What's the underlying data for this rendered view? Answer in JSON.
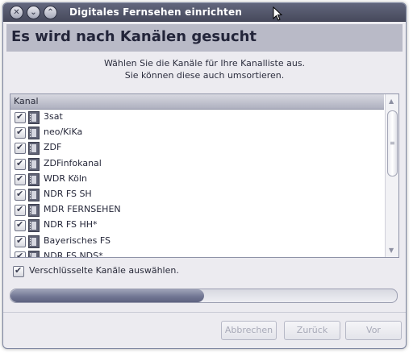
{
  "window": {
    "title": "Digitales Fernsehen einrichten"
  },
  "header": {
    "title": "Es wird nach Kanälen gesucht"
  },
  "intro": {
    "line1": "Wählen Sie die Kanäle für Ihre Kanalliste aus.",
    "line2": "Sie können diese auch umsortieren."
  },
  "channel_list": {
    "column_header": "Kanal",
    "channels": [
      {
        "name": "3sat",
        "checked": true
      },
      {
        "name": "neo/KiKa",
        "checked": true
      },
      {
        "name": "ZDF",
        "checked": true
      },
      {
        "name": "ZDFinfokanal",
        "checked": true
      },
      {
        "name": "WDR Köln",
        "checked": true
      },
      {
        "name": "NDR FS SH",
        "checked": true
      },
      {
        "name": "MDR FERNSEHEN",
        "checked": true
      },
      {
        "name": "NDR FS HH*",
        "checked": true
      },
      {
        "name": "Bayerisches FS",
        "checked": true
      },
      {
        "name": "NDR FS NDS*",
        "checked": true
      }
    ]
  },
  "options": {
    "encrypted_label": "Verschlüsselte Kanäle auswählen.",
    "encrypted_checked": true
  },
  "progress": {
    "fraction": 0.5
  },
  "buttons": {
    "cancel": "Abbrechen",
    "back": "Zurück",
    "next": "Vor"
  },
  "icons": {
    "titlebar": [
      "close-icon",
      "minimize-icon",
      "maximize-icon"
    ],
    "channel": "tv-channel-icon"
  }
}
